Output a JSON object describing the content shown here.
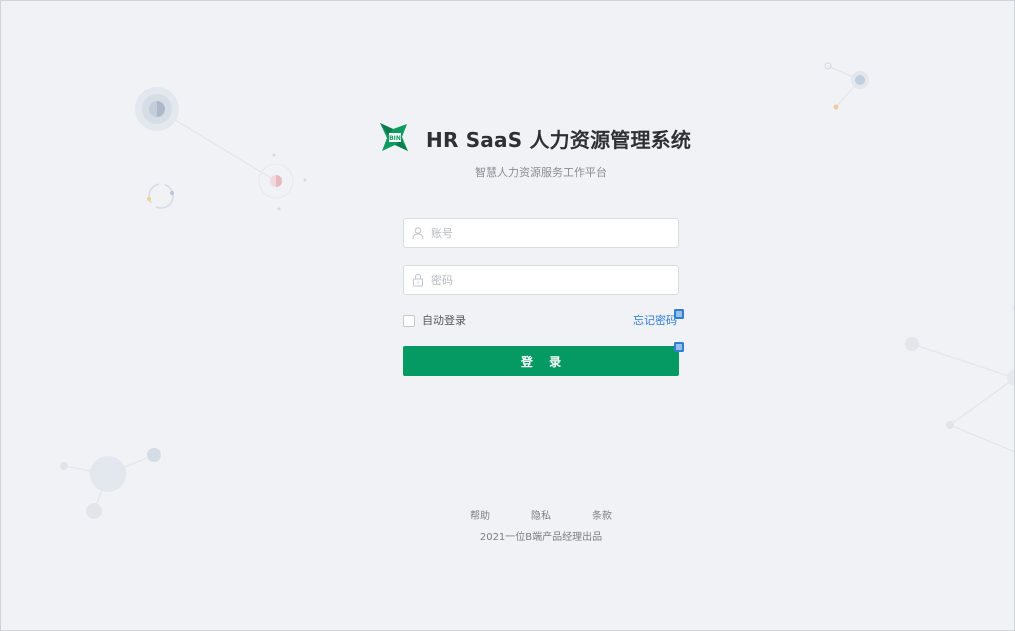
{
  "app": {
    "title": "HR SaaS 人力资源管理系统",
    "subtitle": "智慧人力资源服务工作平台",
    "logo_text": "BIN",
    "brand_color": "#059a63"
  },
  "form": {
    "account": {
      "placeholder": "账号",
      "value": "",
      "icon": "user-icon"
    },
    "password": {
      "placeholder": "密码",
      "value": "",
      "icon": "lock-icon"
    },
    "remember_label": "自动登录",
    "remember_checked": false,
    "forgot_label": "忘记密码",
    "login_label": "登 录"
  },
  "footer": {
    "links": [
      "帮助",
      "隐私",
      "条款"
    ],
    "copyright": "2021一位B端产品经理出品"
  },
  "colors": {
    "background": "#f0f2f5",
    "link": "#2c7bd6",
    "note_badge": "#2f7fd2"
  }
}
